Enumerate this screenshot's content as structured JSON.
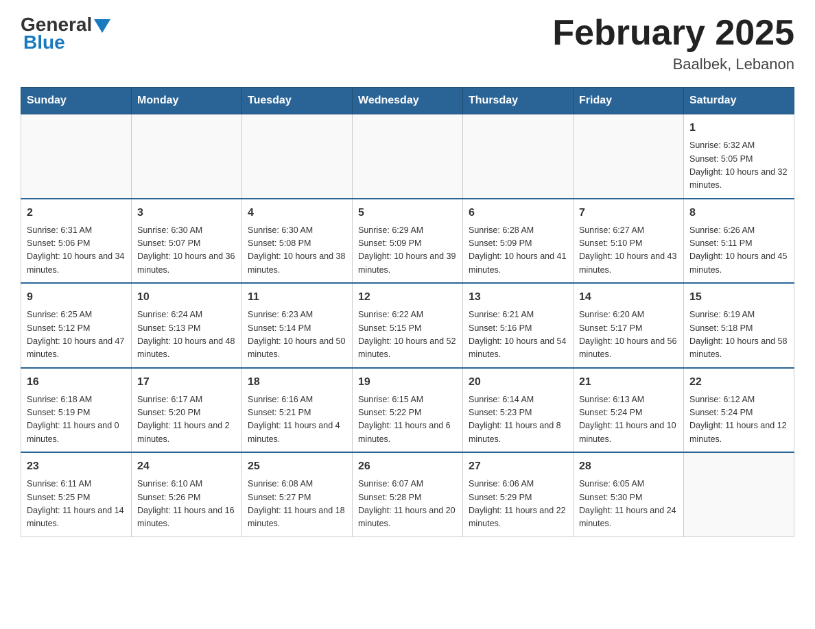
{
  "header": {
    "logo_general": "General",
    "logo_blue": "Blue",
    "title": "February 2025",
    "subtitle": "Baalbek, Lebanon"
  },
  "weekdays": [
    "Sunday",
    "Monday",
    "Tuesday",
    "Wednesday",
    "Thursday",
    "Friday",
    "Saturday"
  ],
  "weeks": [
    [
      {
        "day": "",
        "info": ""
      },
      {
        "day": "",
        "info": ""
      },
      {
        "day": "",
        "info": ""
      },
      {
        "day": "",
        "info": ""
      },
      {
        "day": "",
        "info": ""
      },
      {
        "day": "",
        "info": ""
      },
      {
        "day": "1",
        "info": "Sunrise: 6:32 AM\nSunset: 5:05 PM\nDaylight: 10 hours and 32 minutes."
      }
    ],
    [
      {
        "day": "2",
        "info": "Sunrise: 6:31 AM\nSunset: 5:06 PM\nDaylight: 10 hours and 34 minutes."
      },
      {
        "day": "3",
        "info": "Sunrise: 6:30 AM\nSunset: 5:07 PM\nDaylight: 10 hours and 36 minutes."
      },
      {
        "day": "4",
        "info": "Sunrise: 6:30 AM\nSunset: 5:08 PM\nDaylight: 10 hours and 38 minutes."
      },
      {
        "day": "5",
        "info": "Sunrise: 6:29 AM\nSunset: 5:09 PM\nDaylight: 10 hours and 39 minutes."
      },
      {
        "day": "6",
        "info": "Sunrise: 6:28 AM\nSunset: 5:09 PM\nDaylight: 10 hours and 41 minutes."
      },
      {
        "day": "7",
        "info": "Sunrise: 6:27 AM\nSunset: 5:10 PM\nDaylight: 10 hours and 43 minutes."
      },
      {
        "day": "8",
        "info": "Sunrise: 6:26 AM\nSunset: 5:11 PM\nDaylight: 10 hours and 45 minutes."
      }
    ],
    [
      {
        "day": "9",
        "info": "Sunrise: 6:25 AM\nSunset: 5:12 PM\nDaylight: 10 hours and 47 minutes."
      },
      {
        "day": "10",
        "info": "Sunrise: 6:24 AM\nSunset: 5:13 PM\nDaylight: 10 hours and 48 minutes."
      },
      {
        "day": "11",
        "info": "Sunrise: 6:23 AM\nSunset: 5:14 PM\nDaylight: 10 hours and 50 minutes."
      },
      {
        "day": "12",
        "info": "Sunrise: 6:22 AM\nSunset: 5:15 PM\nDaylight: 10 hours and 52 minutes."
      },
      {
        "day": "13",
        "info": "Sunrise: 6:21 AM\nSunset: 5:16 PM\nDaylight: 10 hours and 54 minutes."
      },
      {
        "day": "14",
        "info": "Sunrise: 6:20 AM\nSunset: 5:17 PM\nDaylight: 10 hours and 56 minutes."
      },
      {
        "day": "15",
        "info": "Sunrise: 6:19 AM\nSunset: 5:18 PM\nDaylight: 10 hours and 58 minutes."
      }
    ],
    [
      {
        "day": "16",
        "info": "Sunrise: 6:18 AM\nSunset: 5:19 PM\nDaylight: 11 hours and 0 minutes."
      },
      {
        "day": "17",
        "info": "Sunrise: 6:17 AM\nSunset: 5:20 PM\nDaylight: 11 hours and 2 minutes."
      },
      {
        "day": "18",
        "info": "Sunrise: 6:16 AM\nSunset: 5:21 PM\nDaylight: 11 hours and 4 minutes."
      },
      {
        "day": "19",
        "info": "Sunrise: 6:15 AM\nSunset: 5:22 PM\nDaylight: 11 hours and 6 minutes."
      },
      {
        "day": "20",
        "info": "Sunrise: 6:14 AM\nSunset: 5:23 PM\nDaylight: 11 hours and 8 minutes."
      },
      {
        "day": "21",
        "info": "Sunrise: 6:13 AM\nSunset: 5:24 PM\nDaylight: 11 hours and 10 minutes."
      },
      {
        "day": "22",
        "info": "Sunrise: 6:12 AM\nSunset: 5:24 PM\nDaylight: 11 hours and 12 minutes."
      }
    ],
    [
      {
        "day": "23",
        "info": "Sunrise: 6:11 AM\nSunset: 5:25 PM\nDaylight: 11 hours and 14 minutes."
      },
      {
        "day": "24",
        "info": "Sunrise: 6:10 AM\nSunset: 5:26 PM\nDaylight: 11 hours and 16 minutes."
      },
      {
        "day": "25",
        "info": "Sunrise: 6:08 AM\nSunset: 5:27 PM\nDaylight: 11 hours and 18 minutes."
      },
      {
        "day": "26",
        "info": "Sunrise: 6:07 AM\nSunset: 5:28 PM\nDaylight: 11 hours and 20 minutes."
      },
      {
        "day": "27",
        "info": "Sunrise: 6:06 AM\nSunset: 5:29 PM\nDaylight: 11 hours and 22 minutes."
      },
      {
        "day": "28",
        "info": "Sunrise: 6:05 AM\nSunset: 5:30 PM\nDaylight: 11 hours and 24 minutes."
      },
      {
        "day": "",
        "info": ""
      }
    ]
  ]
}
